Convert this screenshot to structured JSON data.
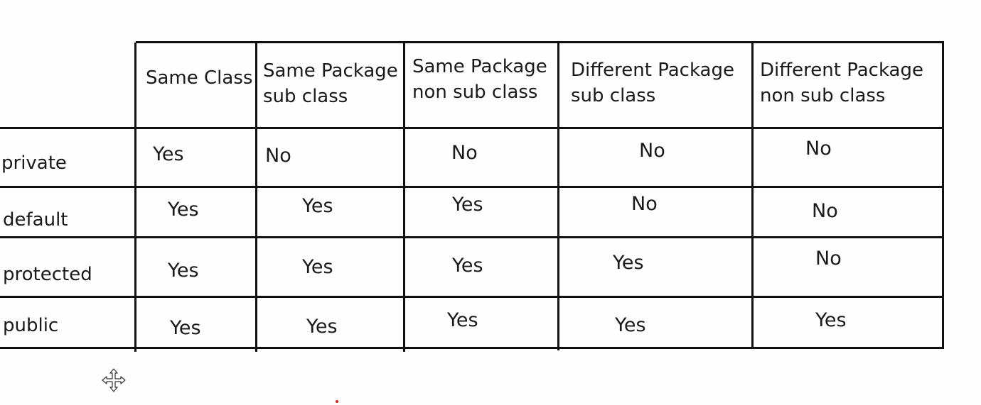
{
  "table": {
    "columns": [
      "Same Class",
      [
        "Same Package",
        "sub class"
      ],
      [
        "Same Package",
        "non sub class"
      ],
      [
        "Different Package",
        "sub class"
      ],
      [
        "Different Package",
        "non sub class"
      ]
    ],
    "rows": [
      {
        "label": "private",
        "cells": [
          "Yes",
          "No",
          "No",
          "No",
          "No"
        ]
      },
      {
        "label": "default",
        "cells": [
          "Yes",
          "Yes",
          "Yes",
          "No",
          "No"
        ]
      },
      {
        "label": "protected",
        "cells": [
          "Yes",
          "Yes",
          "Yes",
          "Yes",
          "No"
        ]
      },
      {
        "label": "public",
        "cells": [
          "Yes",
          "Yes",
          "Yes",
          "Yes",
          "Yes"
        ]
      }
    ]
  },
  "icons": {
    "cursor": "move-cursor-icon"
  },
  "colors": {
    "grid": "#111111",
    "background": "#ffffff",
    "dot": "#d32020"
  }
}
